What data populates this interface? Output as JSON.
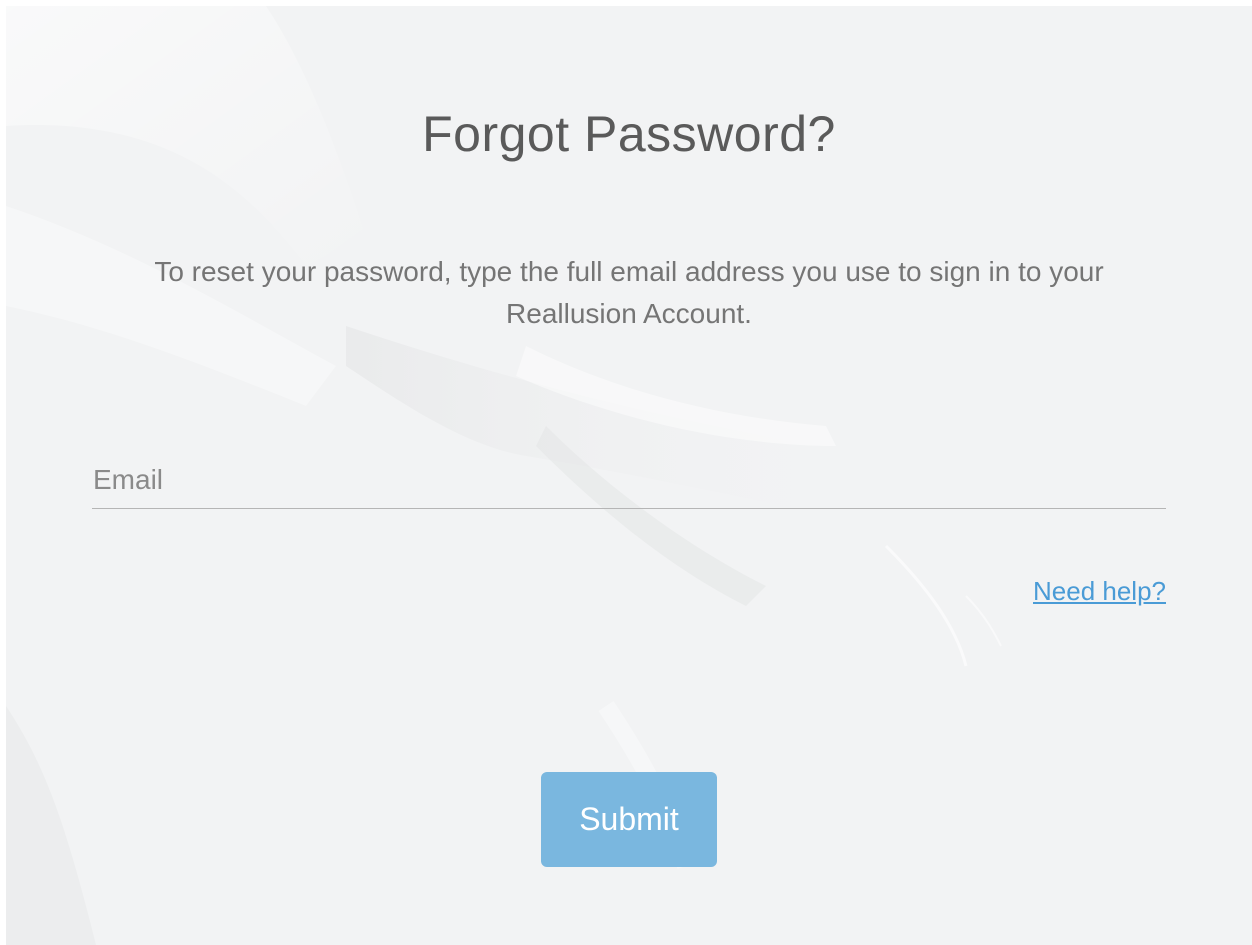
{
  "page": {
    "title": "Forgot Password?",
    "instructions": "To reset your password, type the full email address you use to sign in to your Reallusion Account."
  },
  "form": {
    "email_placeholder": "Email",
    "email_value": "",
    "help_link": "Need help?",
    "submit_label": "Submit"
  },
  "colors": {
    "background": "#f2f3f4",
    "link": "#4a9bd6",
    "button": "#7ab7df",
    "title_text": "#5a5a5a"
  }
}
